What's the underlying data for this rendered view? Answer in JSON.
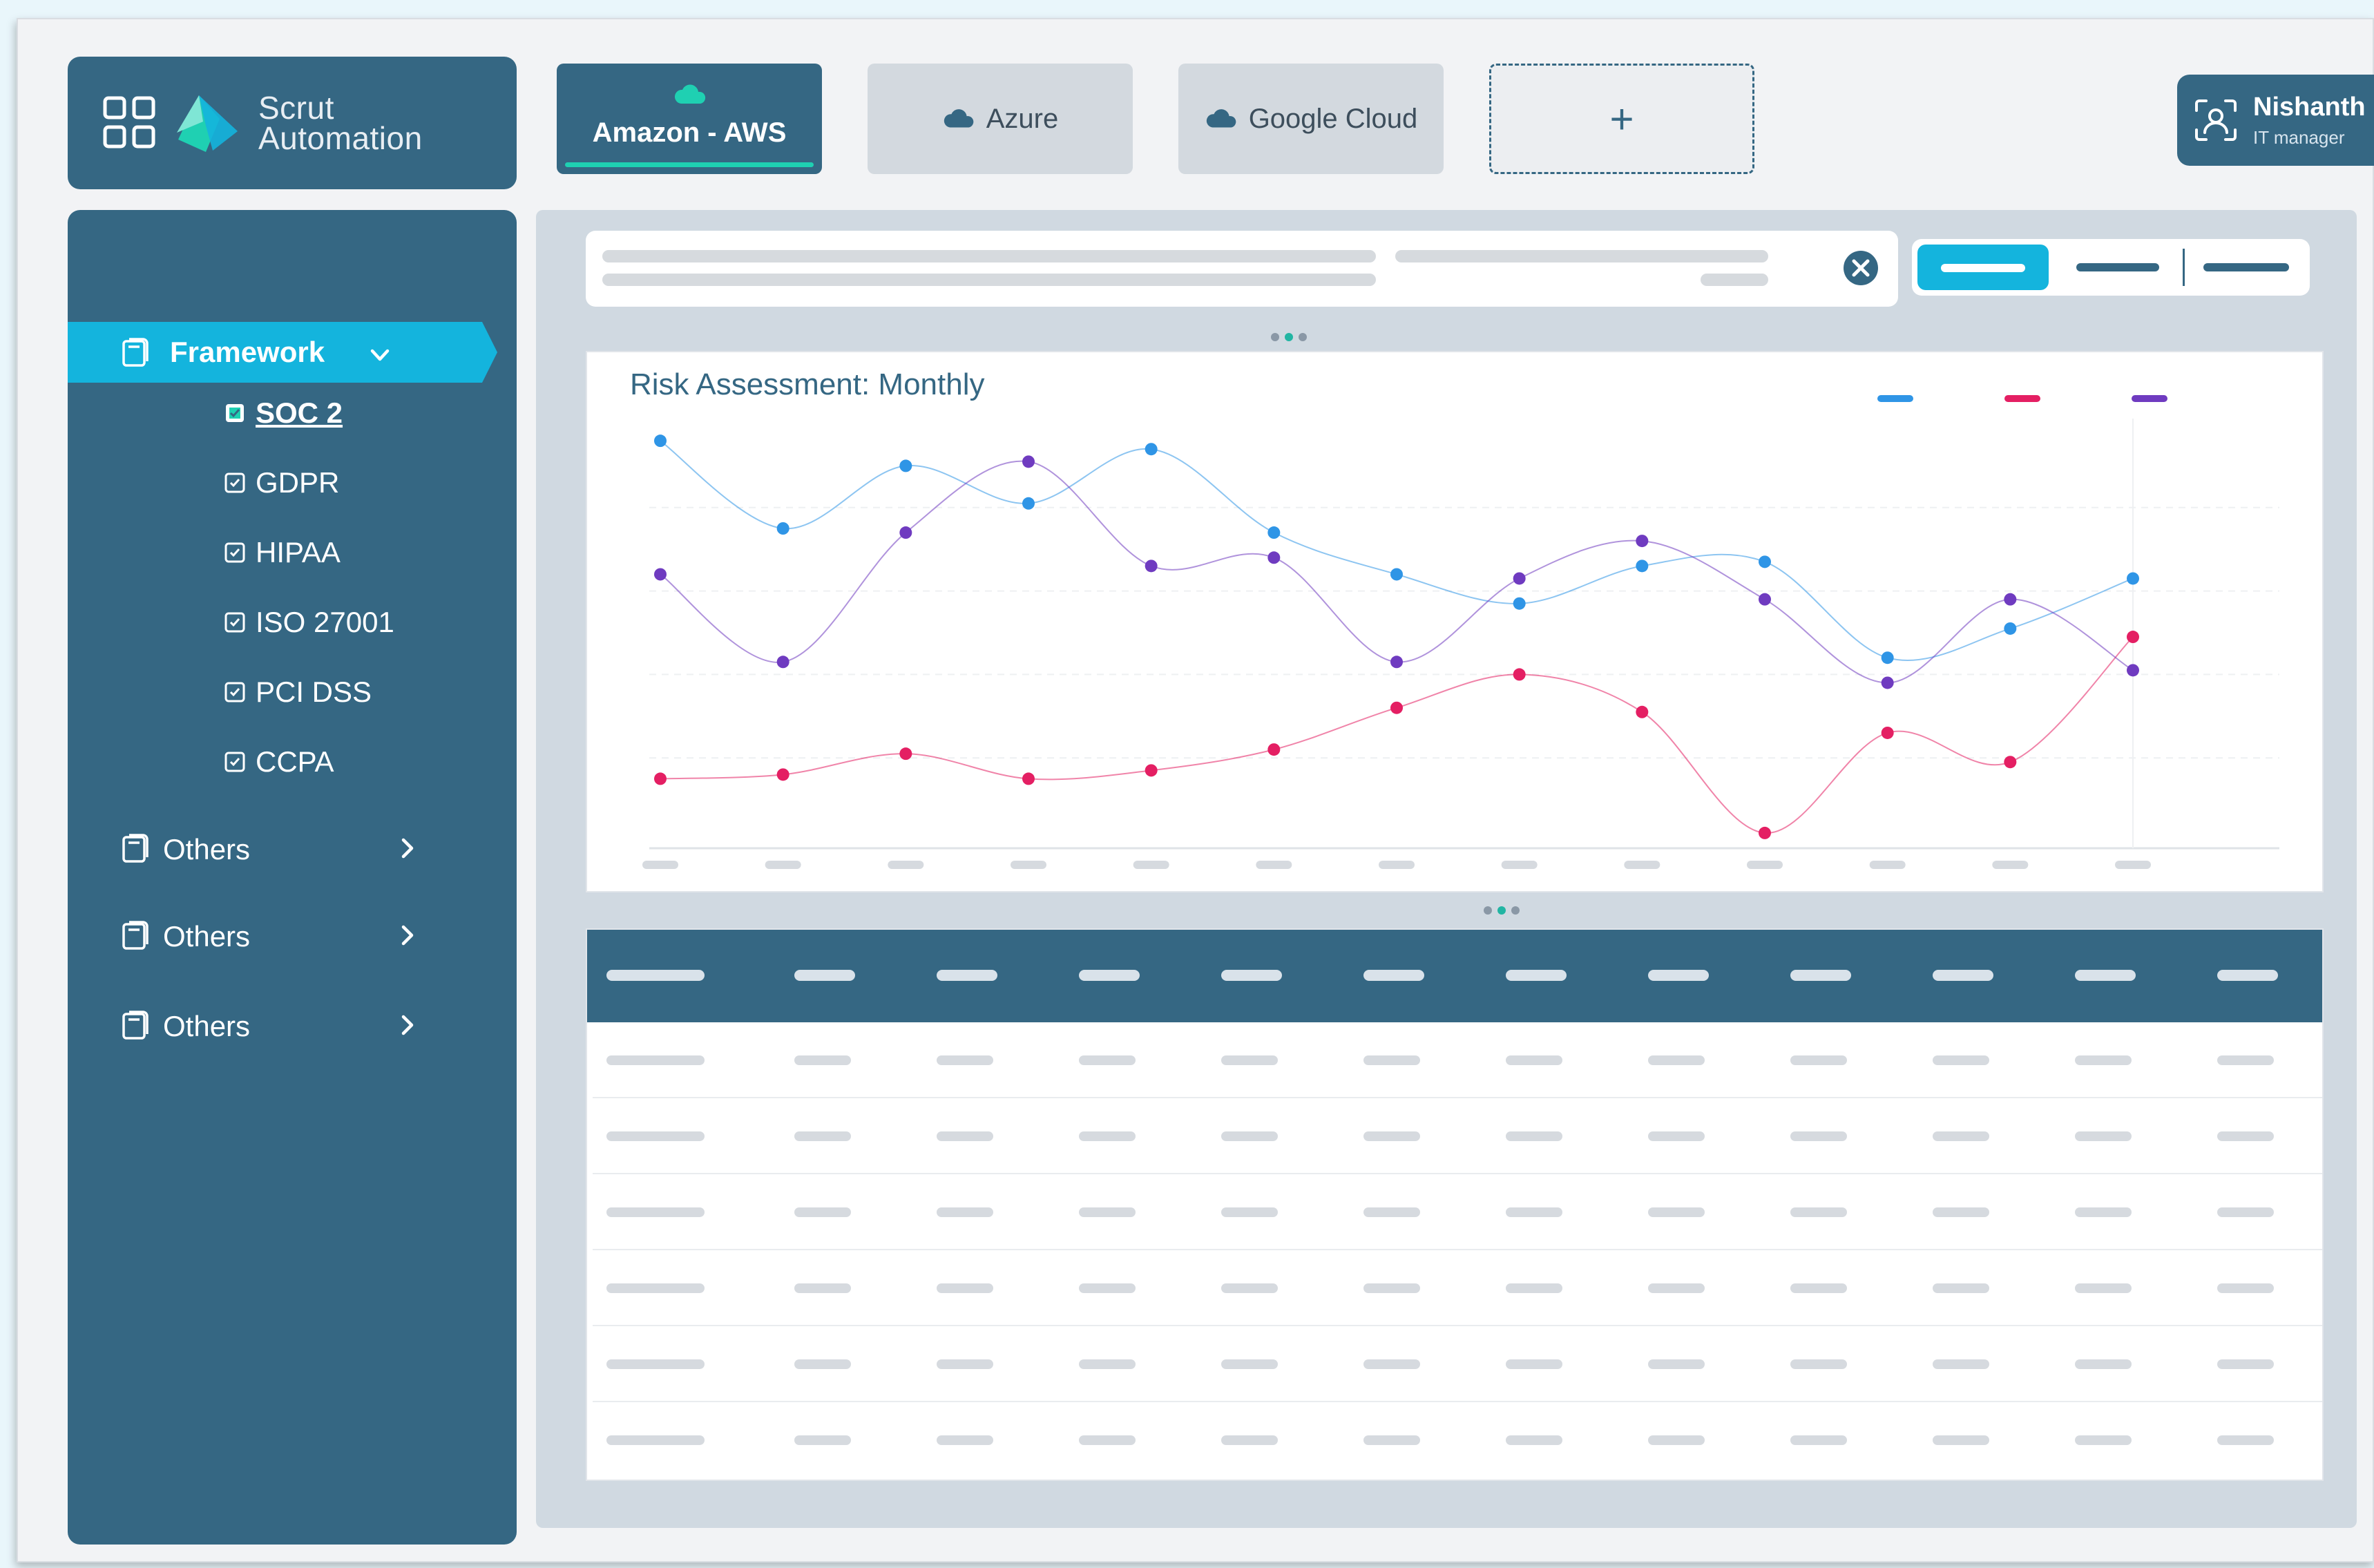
{
  "brand": {
    "name_line1": "Scrut",
    "name_line2": "Automation"
  },
  "tabs": [
    {
      "label": "Amazon - AWS",
      "active": true,
      "icon": "cloud-icon"
    },
    {
      "label": "Azure",
      "active": false,
      "icon": "cloud-icon"
    },
    {
      "label": "Google Cloud",
      "active": false,
      "icon": "cloud-icon"
    },
    {
      "label": "+",
      "active": false,
      "icon": "plus-icon"
    }
  ],
  "user": {
    "name": "Nishanth",
    "role": "IT manager",
    "icon": "user-scan-icon"
  },
  "sidebar": {
    "framework_label": "Framework",
    "frameworks": [
      "SOC 2",
      "GDPR",
      "HIPAA",
      "ISO 27001",
      "PCI DSS",
      "CCPA"
    ],
    "selected_framework": "SOC 2",
    "others": [
      "Others",
      "Others",
      "Others"
    ]
  },
  "colors": {
    "primary": "#356783",
    "accent": "#14b4dd",
    "teal": "#1fd0b2",
    "series_blue": "#2f95e6",
    "series_red": "#e41f63",
    "series_purple": "#6f3bc0"
  },
  "chart_data": {
    "type": "line",
    "title": "Risk Assessment: Monthly",
    "x": [
      1,
      2,
      3,
      4,
      5,
      6,
      7,
      8,
      9,
      10,
      11,
      12,
      13
    ],
    "ylim": [
      0,
      100
    ],
    "grid": true,
    "legend": "top-right",
    "series": [
      {
        "color": "#2f95e6",
        "values": [
          96,
          75,
          90,
          81,
          94,
          74,
          64,
          57,
          66,
          67,
          44,
          51,
          63
        ]
      },
      {
        "color": "#e41f63",
        "values": [
          15,
          16,
          21,
          15,
          17,
          22,
          32,
          40,
          31,
          2,
          26,
          19,
          49
        ]
      },
      {
        "color": "#6f3bc0",
        "values": [
          64,
          43,
          74,
          91,
          66,
          68,
          43,
          63,
          72,
          58,
          38,
          58,
          41
        ]
      }
    ]
  }
}
